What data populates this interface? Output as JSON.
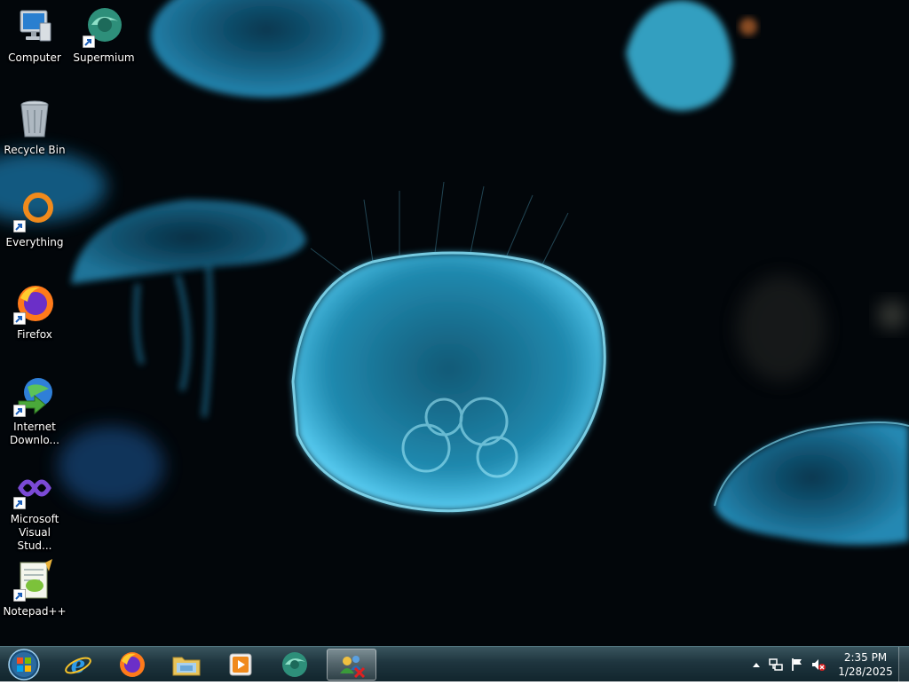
{
  "desktop": {
    "icons": [
      {
        "label": "Computer",
        "icon": "computer-icon"
      },
      {
        "label": "Supermium",
        "icon": "supermium-icon"
      },
      {
        "label": "Recycle Bin",
        "icon": "recycle-bin-icon"
      },
      {
        "label": "Everything",
        "icon": "everything-icon"
      },
      {
        "label": "Firefox",
        "icon": "firefox-icon"
      },
      {
        "label": "Internet Downlo...",
        "icon": "internet-download-manager-icon"
      },
      {
        "label": "Microsoft Visual Stud...",
        "icon": "visual-studio-icon"
      },
      {
        "label": "Notepad++",
        "icon": "notepad-plus-plus-icon"
      }
    ]
  },
  "taskbar": {
    "start": "start-orb-icon",
    "pinned": [
      {
        "icon": "internet-explorer-icon",
        "active": false
      },
      {
        "icon": "firefox-icon",
        "active": false
      },
      {
        "icon": "file-explorer-icon",
        "active": false
      },
      {
        "icon": "media-player-icon",
        "active": false
      },
      {
        "icon": "supermium-icon",
        "active": false
      },
      {
        "icon": "network-users-icon",
        "active": true
      }
    ],
    "tray": {
      "icons": [
        "show-hidden-icons-chevron",
        "network-icon",
        "action-center-flag-icon",
        "volume-muted-icon"
      ],
      "time": "2:35 PM",
      "date": "1/28/2025"
    }
  }
}
